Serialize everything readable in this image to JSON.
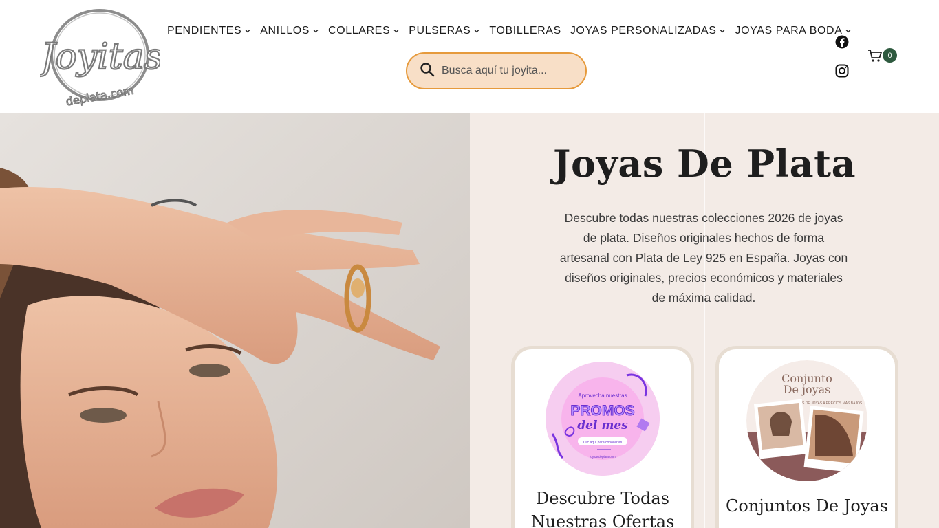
{
  "brand": {
    "logo_text": "Joyitas",
    "logo_subtext": "deplata.com"
  },
  "nav": {
    "items": [
      {
        "label": "PENDIENTES",
        "has_dropdown": true
      },
      {
        "label": "ANILLOS",
        "has_dropdown": true
      },
      {
        "label": "COLLARES",
        "has_dropdown": true
      },
      {
        "label": "PULSERAS",
        "has_dropdown": true
      },
      {
        "label": "TOBILLERAS",
        "has_dropdown": false
      },
      {
        "label": "JOYAS PERSONALIZADAS",
        "has_dropdown": true
      },
      {
        "label": "JOYAS PARA BODA",
        "has_dropdown": true
      }
    ]
  },
  "search": {
    "placeholder": "Busca aquí tu joyita..."
  },
  "social": {
    "icons": [
      "facebook-icon",
      "instagram-icon"
    ]
  },
  "cart": {
    "count": "0"
  },
  "hero": {
    "title": "Joyas De Plata",
    "description": "Descubre todas nuestras colecciones 2026 de joyas de plata. Diseños originales hechos de forma artesanal con Plata de Ley 925 en España. Joyas con diseños originales, precios económicos y materiales de máxima calidad."
  },
  "cards": [
    {
      "title": "Descubre Todas Nuestras Ofertas",
      "image_text": {
        "line1": "Aprovecha nuestras",
        "line2": "PROMOS",
        "line3": "del mes",
        "button": "Clic aquí para conocerlas",
        "url": "joyitasdeplata.com"
      }
    },
    {
      "title": "Conjuntos De Joyas",
      "image_text": {
        "line1": "Conjunto",
        "line2": "De joyas",
        "line3": "PACKS DE JOYAS A PRECIOS MÁS BAJOS"
      }
    }
  ],
  "colors": {
    "search_bg": "#f8dfc7",
    "search_border": "#e69a3c",
    "cart_badge": "#2e5a3f",
    "hero_bg": "#f3ebe6"
  }
}
